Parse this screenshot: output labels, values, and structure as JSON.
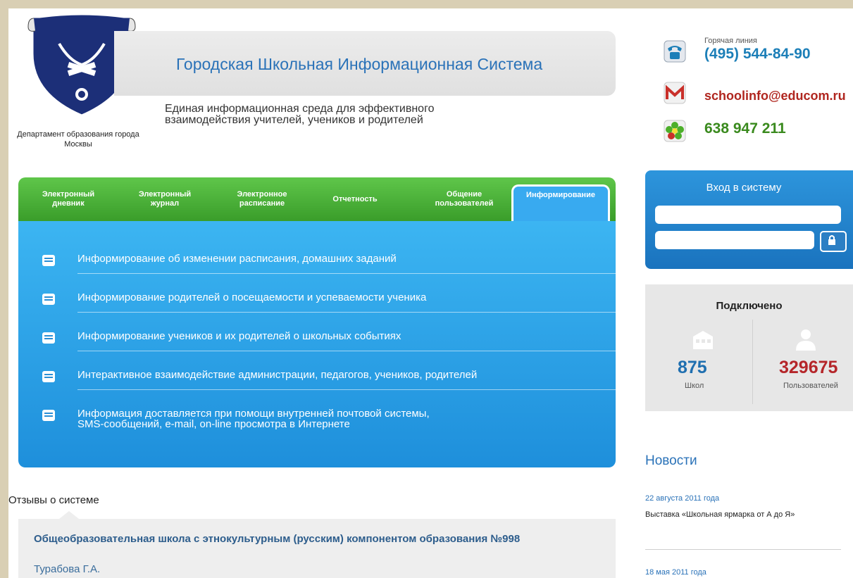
{
  "header": {
    "department": "Департамент образования города Москвы",
    "title": "Городская Школьная Информационная Система",
    "subtitle_line1": "Единая информационная среда для эффективного",
    "subtitle_line2": "взаимодействия учителей, учеников и родителей"
  },
  "contacts": {
    "hotline_label": "Горячая линия",
    "phone": "(495) 544-84-90",
    "email": "schoolinfo@educom.ru",
    "icq": "638 947 211",
    "icons": [
      "phone-icon",
      "mail-icon",
      "icq-icon"
    ]
  },
  "tabs": [
    {
      "label": "Электронный\nдневник",
      "active": false
    },
    {
      "label": "Электронный\nжурнал",
      "active": false
    },
    {
      "label": "Электронное\nрасписание",
      "active": false
    },
    {
      "label": "Отчетность",
      "active": false
    },
    {
      "label": "Общение\nпользователей",
      "active": false
    },
    {
      "label": "Информирование",
      "active": true
    }
  ],
  "info_items": [
    "Информирование об изменении расписания, домашних заданий",
    "Информирование родителей о посещаемости и успеваемости ученика",
    "Информирование учеников и их родителей о школьных событиях",
    "Интерактивное взаимодействие администрации, педагогов, учеников, родителей",
    "Информация доставляется при помощи внутренней почтовой системы,\nSMS-сообщений, e-mail, on-line просмотра в Интернете"
  ],
  "reviews": {
    "heading": "Отзывы о системе",
    "school": "Общеобразовательная школа с этнокультурным (русским) компонентом образования №998",
    "author": "Турабова Г.А."
  },
  "login": {
    "heading": "Вход в систему",
    "login_value": "",
    "password_value": ""
  },
  "stats": {
    "heading": "Подключено",
    "schools_count": "875",
    "schools_label": "Школ",
    "users_count": "329675",
    "users_label": "Пользователей",
    "schools_color": "#1f6fb0",
    "users_color": "#b5262a"
  },
  "news": {
    "heading": "Новости",
    "items": [
      {
        "date": "22 августа 2011 года",
        "text": "Выставка «Школьная ярмарка от А до Я»"
      },
      {
        "date": "18 мая 2011 года",
        "text": ""
      }
    ]
  },
  "colors": {
    "tab_green": "#4fb83c",
    "panel_blue": "#2a9ee6",
    "title_blue": "#2a72b8"
  }
}
